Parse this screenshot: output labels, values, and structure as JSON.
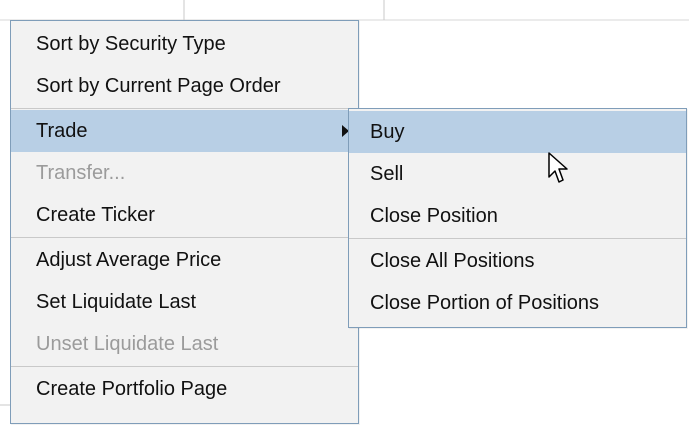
{
  "main_menu": {
    "items": [
      {
        "label": "Sort by Security Type",
        "state": "normal"
      },
      {
        "label": "Sort by Current Page Order",
        "state": "normal"
      },
      {
        "label": "Trade",
        "state": "highlighted",
        "has_submenu": true
      },
      {
        "label": "Transfer...",
        "state": "disabled"
      },
      {
        "label": "Create Ticker",
        "state": "normal"
      },
      {
        "label": "Adjust Average Price",
        "state": "normal"
      },
      {
        "label": "Set Liquidate Last",
        "state": "normal"
      },
      {
        "label": "Unset Liquidate Last",
        "state": "disabled"
      },
      {
        "label": "Create Portfolio Page",
        "state": "normal"
      }
    ]
  },
  "trade_submenu": {
    "items": [
      {
        "label": "Buy",
        "state": "highlighted"
      },
      {
        "label": "Sell",
        "state": "normal"
      },
      {
        "label": "Close Position",
        "state": "normal"
      },
      {
        "label": "Close All Positions",
        "state": "normal"
      },
      {
        "label": "Close Portion of Positions",
        "state": "normal"
      }
    ]
  },
  "colors": {
    "menu_background": "#f2f2f2",
    "menu_border": "#7f9db9",
    "highlight": "#b8cfe5",
    "disabled_text": "#9b9b9b",
    "separator": "#c9c9c9"
  },
  "icons": {
    "submenu_arrow": "chevron-right-icon",
    "pointer": "mouse-cursor-icon"
  }
}
